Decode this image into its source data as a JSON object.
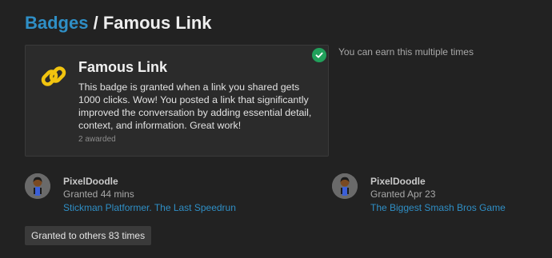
{
  "breadcrumb": {
    "parent_label": "Badges",
    "separator": "/",
    "current_label": "Famous Link"
  },
  "badge": {
    "icon": "link-icon",
    "name": "Famous Link",
    "description": "This badge is granted when a link you shared gets 1000 clicks. Wow! You posted a link that significantly improved the conversation by adding essential detail, context, and information. Great work!",
    "awarded_count": "2 awarded",
    "earned_indicator": "check-circle-icon"
  },
  "multiple_note": "You can earn this multiple times",
  "grants": [
    {
      "username": "PixelDoodle",
      "granted": "Granted 44 mins",
      "topic": "Stickman Platformer. The Last Speedrun"
    },
    {
      "username": "PixelDoodle",
      "granted": "Granted Apr 23",
      "topic": "The Biggest Smash Bros Game"
    }
  ],
  "others_button_label": "Granted to others 83 times",
  "colors": {
    "background": "#222222",
    "link": "#2f8fc6",
    "badge_icon": "#f1c40f",
    "check": "#21a05b"
  }
}
